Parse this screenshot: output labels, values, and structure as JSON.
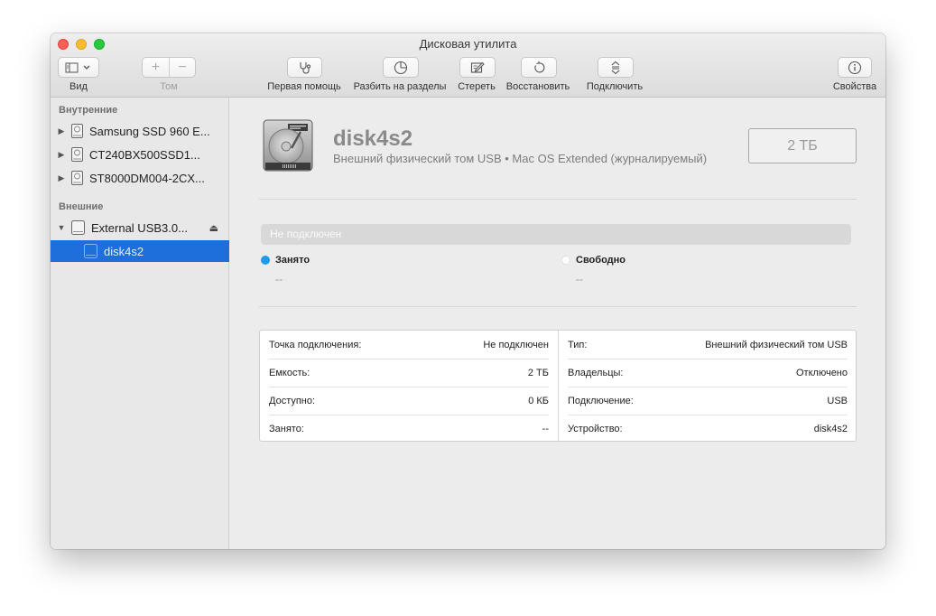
{
  "window": {
    "title": "Дисковая утилита"
  },
  "toolbar": {
    "view_label": "Вид",
    "volume_label": "Том",
    "volume_add": "+",
    "volume_remove": "−",
    "first_aid_label": "Первая помощь",
    "partition_label": "Разбить на разделы",
    "erase_label": "Стереть",
    "restore_label": "Восстановить",
    "mount_label": "Подключить",
    "info_label": "Свойства"
  },
  "sidebar": {
    "internal_heading": "Внутренние",
    "external_heading": "Внешние",
    "internal_items": [
      {
        "label": "Samsung SSD 960 E..."
      },
      {
        "label": "CT240BX500SSD1..."
      },
      {
        "label": "ST8000DM004-2CX..."
      }
    ],
    "external_items": [
      {
        "label": "External USB3.0...",
        "eject": "⏏"
      },
      {
        "label": "disk4s2"
      }
    ]
  },
  "main": {
    "disk_name": "disk4s2",
    "disk_description": "Внешний физический том USB • Mac OS Extended (журналируемый)",
    "size": "2 ТБ",
    "mount_status": "Не подключен",
    "used_label": "Занято",
    "used_value": "--",
    "free_label": "Свободно",
    "free_value": "--",
    "used_color": "#1e9bf0",
    "free_color": "#ffffff"
  },
  "info": {
    "left": [
      {
        "key": "Точка подключения:",
        "value": "Не подключен"
      },
      {
        "key": "Емкость:",
        "value": "2 ТБ"
      },
      {
        "key": "Доступно:",
        "value": "0 КБ"
      },
      {
        "key": "Занято:",
        "value": "--"
      }
    ],
    "right": [
      {
        "key": "Тип:",
        "value": "Внешний физический том USB"
      },
      {
        "key": "Владельцы:",
        "value": "Отключено"
      },
      {
        "key": "Подключение:",
        "value": "USB"
      },
      {
        "key": "Устройство:",
        "value": "disk4s2"
      }
    ]
  }
}
